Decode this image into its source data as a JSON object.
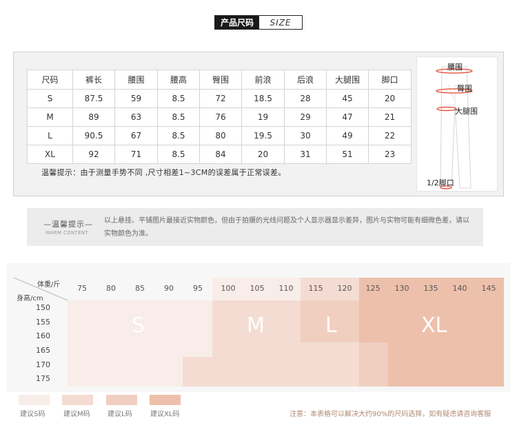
{
  "header": {
    "title_cn": "产品尺码",
    "title_en": "SIZE"
  },
  "size_table": {
    "headers": [
      "尺码",
      "裤长",
      "腰围",
      "腰高",
      "臀围",
      "前浪",
      "后浪",
      "大腿围",
      "脚口"
    ],
    "rows": [
      [
        "S",
        "87.5",
        "59",
        "8.5",
        "72",
        "18.5",
        "28",
        "45",
        "20"
      ],
      [
        "M",
        "89",
        "63",
        "8.5",
        "76",
        "19",
        "29",
        "47",
        "21"
      ],
      [
        "L",
        "90.5",
        "67",
        "8.5",
        "80",
        "19.5",
        "30",
        "49",
        "22"
      ],
      [
        "XL",
        "92",
        "71",
        "8.5",
        "84",
        "20",
        "31",
        "51",
        "23"
      ]
    ]
  },
  "tip": "温馨提示：由于测量手势不同 ,尺寸相差1~3CM的误差属于正常误差。",
  "diagram": {
    "labels": {
      "waist": "腰围",
      "hip": "臀围",
      "thigh": "大腿围",
      "hem": "1/2脚口"
    }
  },
  "warm": {
    "title": "—温馨提示—",
    "subtitle": "WARM CONTENT",
    "text": "以上悬挂、平铺图片最接近实物颜色，但由于拍摄的光线问题及个人显示器显示差异，图片与实物可能有细微色差，请以实物颜色为准。"
  },
  "chart": {
    "weight_label": "体重/斤",
    "height_label": "身高/cm",
    "weights": [
      "75",
      "80",
      "85",
      "90",
      "95",
      "100",
      "105",
      "110",
      "115",
      "120",
      "125",
      "130",
      "135",
      "140",
      "145"
    ],
    "heights": [
      "150",
      "155",
      "160",
      "165",
      "170",
      "175"
    ],
    "zones": [
      "S",
      "M",
      "L",
      "XL"
    ],
    "colors": {
      "S": "#f8ede8",
      "M": "#f4dcd2",
      "L": "#f0cfc0",
      "XL": "#edc0ab"
    }
  },
  "legend": {
    "items": [
      {
        "label": "建议S码",
        "color": "#f8ede8"
      },
      {
        "label": "建议M码",
        "color": "#f4dcd2"
      },
      {
        "label": "建议L码",
        "color": "#f0cfc0"
      },
      {
        "label": "建议XL码",
        "color": "#edc0ab"
      }
    ],
    "note": "注意：本表格可以解决大约90%的尺码选择，如有疑虑请咨询客服"
  }
}
